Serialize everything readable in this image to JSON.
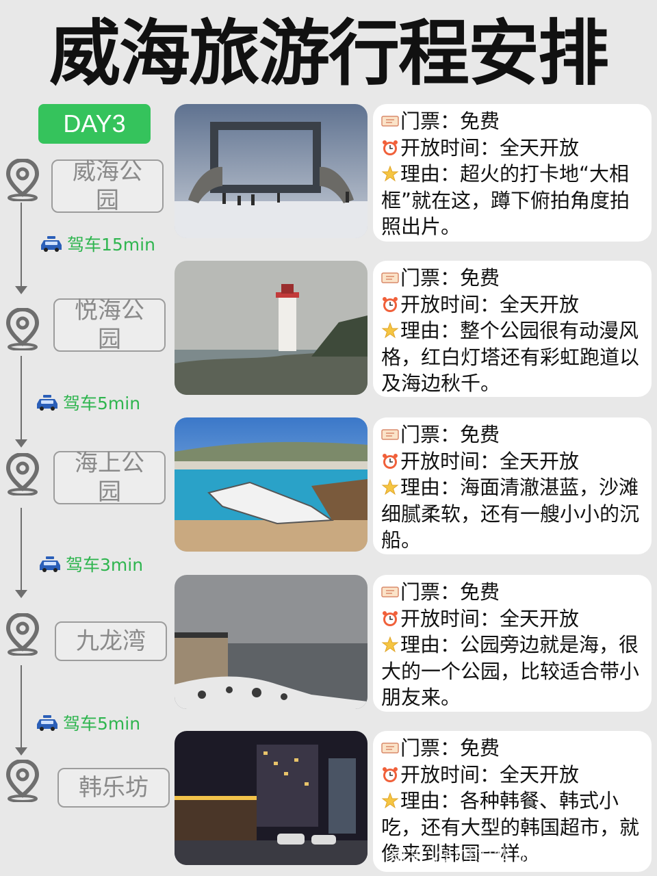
{
  "title": "威海旅游行程安排",
  "day_label": "DAY3",
  "colors": {
    "accent": "#35c35c",
    "drive_text": "#2fb54f",
    "name_text": "#8a8a8a"
  },
  "stops": [
    {
      "name": "威海公园",
      "ticket": "门票：免费",
      "hours": "开放时间：全天开放",
      "reason": "理由：超火的打卡地“大相框”就在这，蹲下俯拍角度拍照出片。"
    },
    {
      "name": "悦海公园",
      "ticket": "门票：免费",
      "hours": "开放时间：全天开放",
      "reason": "理由：整个公园很有动漫风格，红白灯塔还有彩虹跑道以及海边秋千。"
    },
    {
      "name": "海上公园",
      "ticket": "门票：免费",
      "hours": "开放时间：全天开放",
      "reason": "理由：海面清澈湛蓝，沙滩细腻柔软，还有一艘小小的沉船。"
    },
    {
      "name": "九龙湾",
      "ticket": "门票：免费",
      "hours": "开放时间：全天开放",
      "reason": "理由：公园旁边就是海，很大的一个公园，比较适合带小朋友来。"
    },
    {
      "name": "韩乐坊",
      "ticket": "门票：免费",
      "hours": "开放时间：全天开放",
      "reason": "理由：各种韩餐、韩式小吃，还有大型的韩国超市，就像来到韩国一样。"
    }
  ],
  "drives": [
    "驾车15min",
    "驾车5min",
    "驾车3min",
    "驾车5min"
  ],
  "watermark": "知乎 @刘国华·广慧旅游",
  "icons": {
    "pin": "location-pin-icon",
    "car": "taxi-car-icon",
    "ticket": "ticket-icon",
    "clock": "alarm-clock-icon",
    "star": "star-icon"
  }
}
